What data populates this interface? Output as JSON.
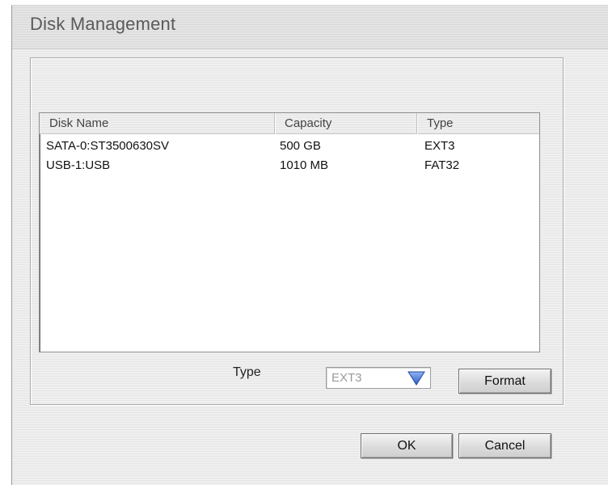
{
  "window": {
    "title": "Disk Management"
  },
  "disk_list": {
    "columns": [
      "Disk Name",
      "Capacity",
      "Type"
    ],
    "rows": [
      {
        "disk_name": "SATA-0:ST3500630SV",
        "capacity": "500 GB",
        "type": "EXT3"
      },
      {
        "disk_name": "USB-1:USB",
        "capacity": "1010 MB",
        "type": "FAT32"
      }
    ]
  },
  "format_options": {
    "type_label": "Type",
    "type_value": "EXT3",
    "format_label": "Format"
  },
  "footer": {
    "ok_label": "OK",
    "cancel_label": "Cancel"
  },
  "colors": {
    "dropdown_arrow": "#3a6fd8"
  },
  "icons": {
    "dropdown": "chevron-down-icon"
  }
}
